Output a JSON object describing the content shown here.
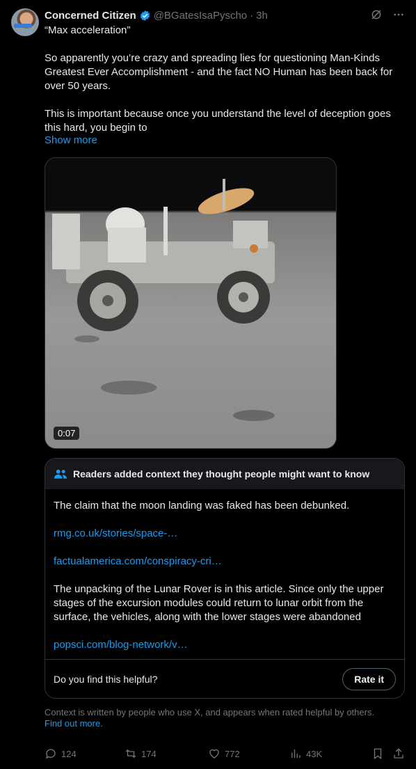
{
  "author": {
    "name": "Concerned Citizen",
    "handle": "@BGatesIsaPyscho",
    "time": "3h",
    "separator": "·"
  },
  "tweet": {
    "paragraphs": [
      "“Max acceleration”",
      "So apparently you’re crazy and spreading lies for questioning Man-Kinds Greatest Ever Accomplishment - and the fact NO Human has been back for over 50 years.",
      "This is important because once you understand the level of deception goes this hard, you begin to"
    ],
    "show_more": "Show more"
  },
  "media": {
    "duration": "0:07"
  },
  "community_note": {
    "header": "Readers added context they thought people might want to know",
    "lines": [
      "The claim that the moon landing was faked has been debunked.",
      "rmg.co.uk/stories/space-…",
      "factualamerica.com/conspiracy-cri…",
      "The unpacking of the Lunar Rover is in this article. Since only the upper stages of the  excursion modules could return to lunar orbit from the surface, the vehicles, along with the lower stages were abandoned",
      "popsci.com/blog-network/v…"
    ],
    "helpful_question": "Do you find this helpful?",
    "rate_button": "Rate it"
  },
  "context_notice": {
    "text": "Context is written by people who use X, and appears when rated helpful by others.",
    "link": "Find out more."
  },
  "actions": {
    "replies": "124",
    "reposts": "174",
    "likes": "772",
    "views": "43K"
  },
  "colors": {
    "background": "#000000",
    "link": "#1d9bf0",
    "muted": "#71767b",
    "verified": "#1d9bf0",
    "repost_green": "#00ba7c"
  }
}
